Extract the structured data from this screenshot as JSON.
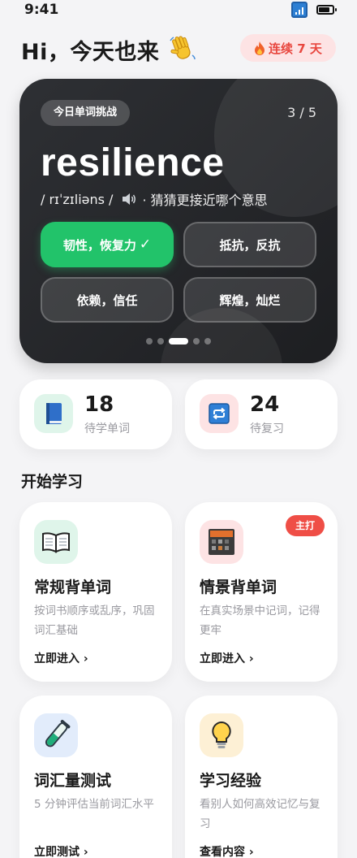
{
  "status_bar": {
    "time": "9:41"
  },
  "header": {
    "greeting": "Hi，今天也来",
    "wave_icon": "waving-hand-icon",
    "streak_label": "连续 7 天",
    "streak_icon": "fire-icon"
  },
  "challenge": {
    "tag": "今日单词挑战",
    "progress": "3 / 5",
    "word": "resilience",
    "phonetic": "/ rɪˈzɪliəns /",
    "hint": "· 猜猜更接近哪个意思",
    "options": [
      {
        "label": "韧性，恢复力",
        "correct": true
      },
      {
        "label": "抵抗，反抗",
        "correct": false
      },
      {
        "label": "依赖，信任",
        "correct": false
      },
      {
        "label": "辉煌，灿烂",
        "correct": false
      }
    ],
    "check_mark": "✓",
    "page_indicator": {
      "total": 5,
      "active": 3
    }
  },
  "stats": [
    {
      "value": "18",
      "label": "待学单词",
      "icon": "book-icon",
      "icon_bg": "#dff5ea"
    },
    {
      "value": "24",
      "label": "待复习",
      "icon": "repeat-icon",
      "icon_bg": "#fde3e4"
    }
  ],
  "section": {
    "title": "开始学习"
  },
  "features": [
    {
      "title": "常规背单词",
      "desc": "按词书顺序或乱序，巩固词汇基础",
      "link": "立即进入 ›",
      "icon": "open-book-icon",
      "icon_bg": "#dff5ea"
    },
    {
      "title": "情景背单词",
      "desc": "在真实场景中记词，记得更牢",
      "link": "立即进入 ›",
      "icon": "scene-icon",
      "icon_bg": "#fde3e4",
      "badge": "主打"
    },
    {
      "title": "词汇量测试",
      "desc": "5 分钟评估当前词汇水平",
      "link": "立即测试 ›",
      "icon": "test-tube-icon",
      "icon_bg": "#e2ecfb"
    },
    {
      "title": "学习经验",
      "desc": "看别人如何高效记忆与复习",
      "link": "查看内容 ›",
      "icon": "lightbulb-icon",
      "icon_bg": "#fdf0d5"
    }
  ],
  "colors": {
    "accent_green": "#22c36a",
    "accent_red": "#ef4e46",
    "dark_card": "#1d1e21"
  }
}
